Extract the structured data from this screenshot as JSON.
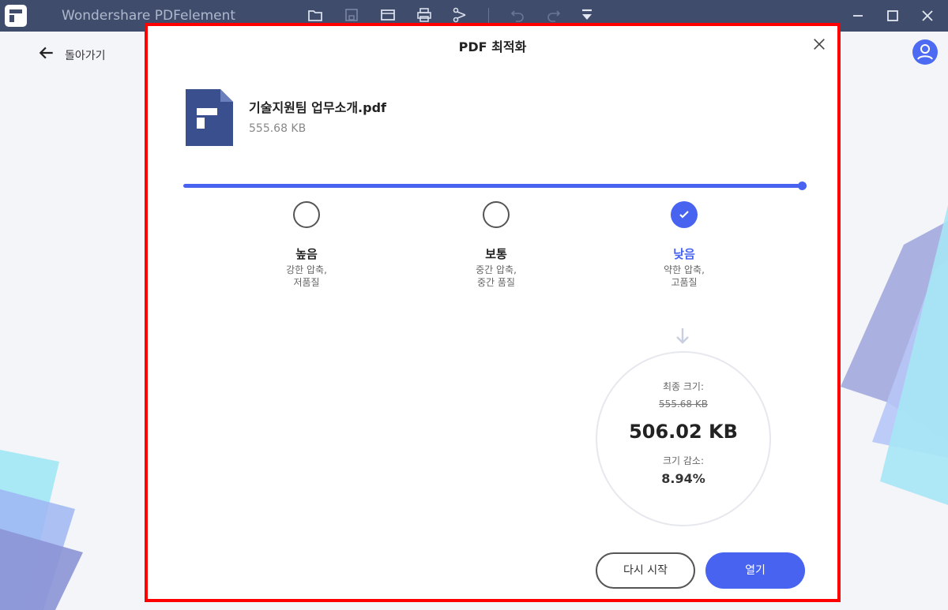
{
  "app": {
    "title": "Wondershare PDFelement"
  },
  "page": {
    "back_label": "돌아가기"
  },
  "dialog": {
    "title": "PDF 최적화",
    "close_icon": "close-icon",
    "file": {
      "name": "기술지원팀 업무소개.pdf",
      "size": "555.68 KB"
    },
    "compression_level": 1.0,
    "options": [
      {
        "label": "높음",
        "desc_line1": "강한 압축,",
        "desc_line2": "저품질",
        "selected": false
      },
      {
        "label": "보통",
        "desc_line1": "중간 압축,",
        "desc_line2": "중간 품질",
        "selected": false
      },
      {
        "label": "낮음",
        "desc_line1": "약한 압축,",
        "desc_line2": "고품질",
        "selected": true
      }
    ],
    "result": {
      "final_label": "최종 크기:",
      "original_size": "555.68 KB",
      "final_size": "506.02 KB",
      "reduction_label": "크기 감소:",
      "reduction_percent": "8.94%"
    },
    "buttons": {
      "restart": "다시 시작",
      "open": "열기"
    }
  },
  "colors": {
    "accent": "#4763f0",
    "titlebar": "#3f4c6b",
    "highlight_border": "#ff0000"
  }
}
